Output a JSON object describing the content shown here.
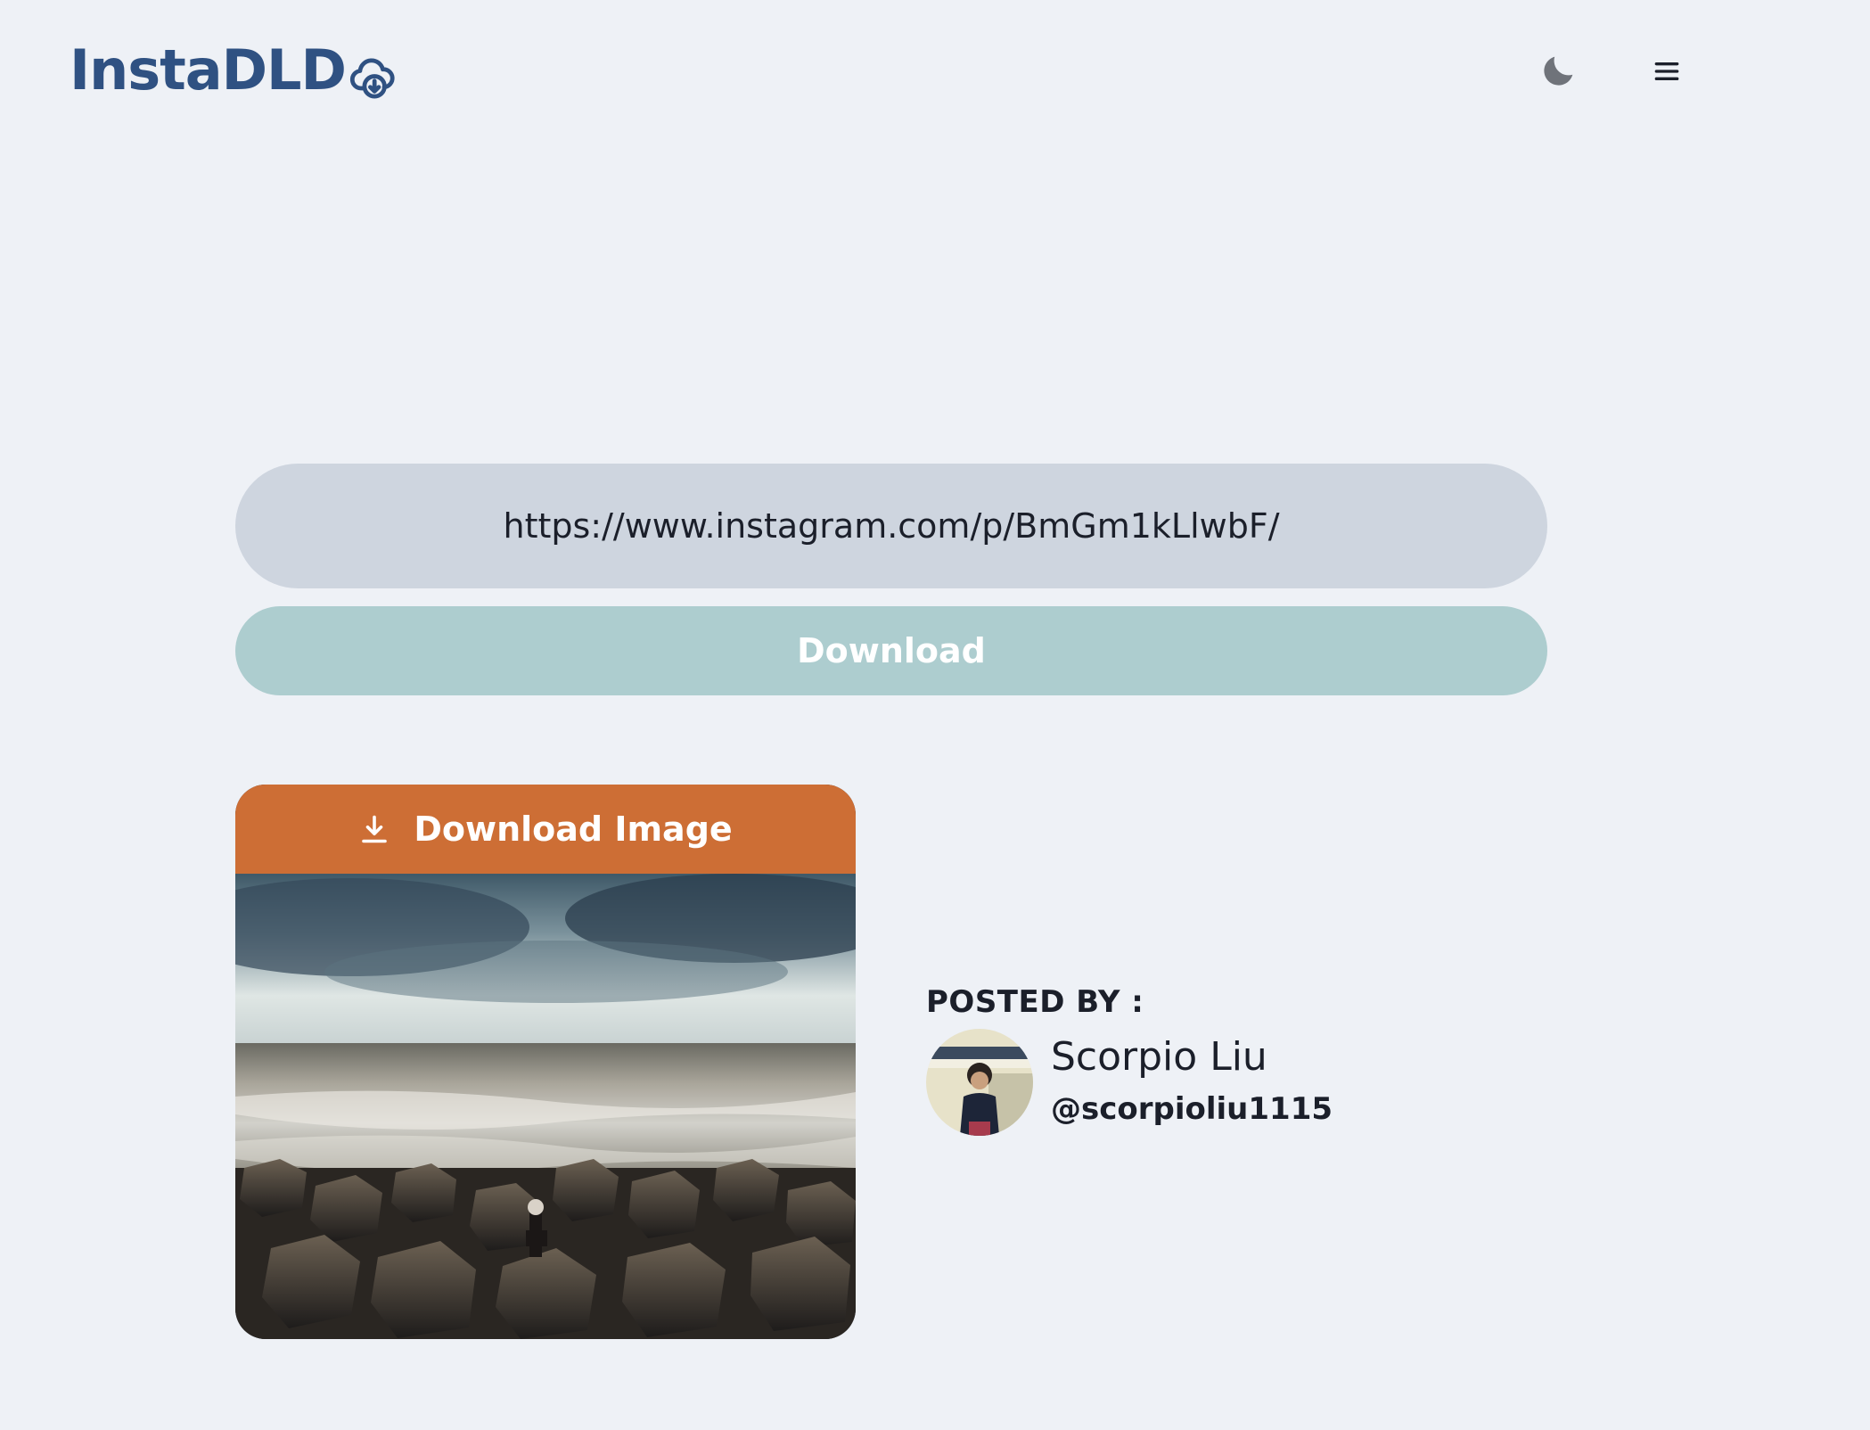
{
  "header": {
    "logo_text": "InstaDLD",
    "logo_icon": "cloud-download-icon",
    "theme_toggle_icon": "moon-icon",
    "menu_icon": "hamburger-menu-icon"
  },
  "form": {
    "url_value": "https://www.instagram.com/p/BmGm1kLlwbF/",
    "download_label": "Download"
  },
  "result": {
    "download_image_label": "Download Image",
    "download_icon": "download-arrow-icon",
    "posted_by_label": "POSTED BY :",
    "author_name": "Scorpio Liu",
    "author_handle": "@scorpioliu1115"
  },
  "colors": {
    "background": "#eef1f6",
    "logo": "#2f5182",
    "input": "#ced5df",
    "download_button": "#adcdcf",
    "card_header": "#cd6e35"
  }
}
